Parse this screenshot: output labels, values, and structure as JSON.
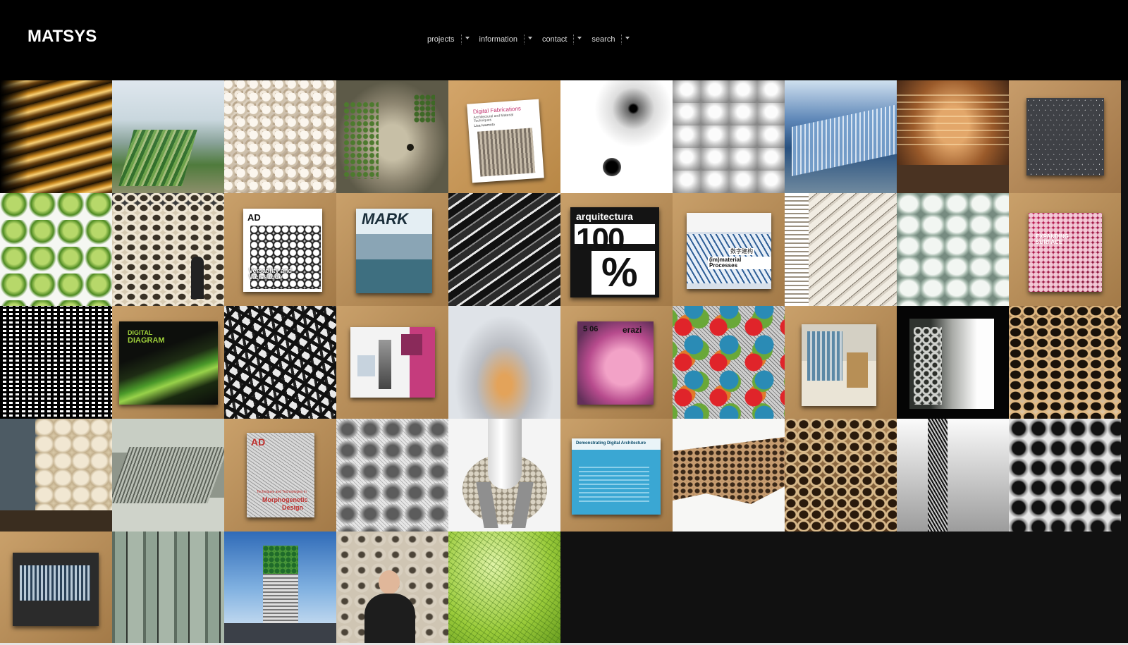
{
  "site": {
    "logo": "MATSYS"
  },
  "nav": [
    {
      "label": "projects"
    },
    {
      "label": "information"
    },
    {
      "label": "contact"
    },
    {
      "label": "search"
    }
  ],
  "magazine_text": {
    "digital_fabrications_title": "Digital Fabrications",
    "digital_fabrications_sub": "Architectural and Material Techniques",
    "digital_fabrications_author": "Lisa Iwamoto",
    "ad_logo": "AD",
    "versatility": "Versatility and Vicissitude",
    "mark": "MARK",
    "arquitectura_head": "arquitectura",
    "arquitectura_big": "100",
    "arquitectura_pct": "%",
    "immaterial": "(im)material Processes",
    "immaterial_cn": "数字建构",
    "expanding": "EXPANDING SURFACE",
    "digital_diagram_1": "DIGITAL",
    "digital_diagram_2": "DIAGRAM",
    "erazi_issue": "5 06",
    "erazi": "erazi",
    "morphogenetic_1": "Morphogenetic",
    "morphogenetic_2": "Design",
    "morphogenetic_sub": "Techniques and Technologies in",
    "demonstrating": "Demonstrating Digital Architecture"
  },
  "colors": {
    "background": "#000000",
    "grid_bg": "#111111",
    "nav_text": "#dddddd",
    "logo": "#ffffff"
  }
}
